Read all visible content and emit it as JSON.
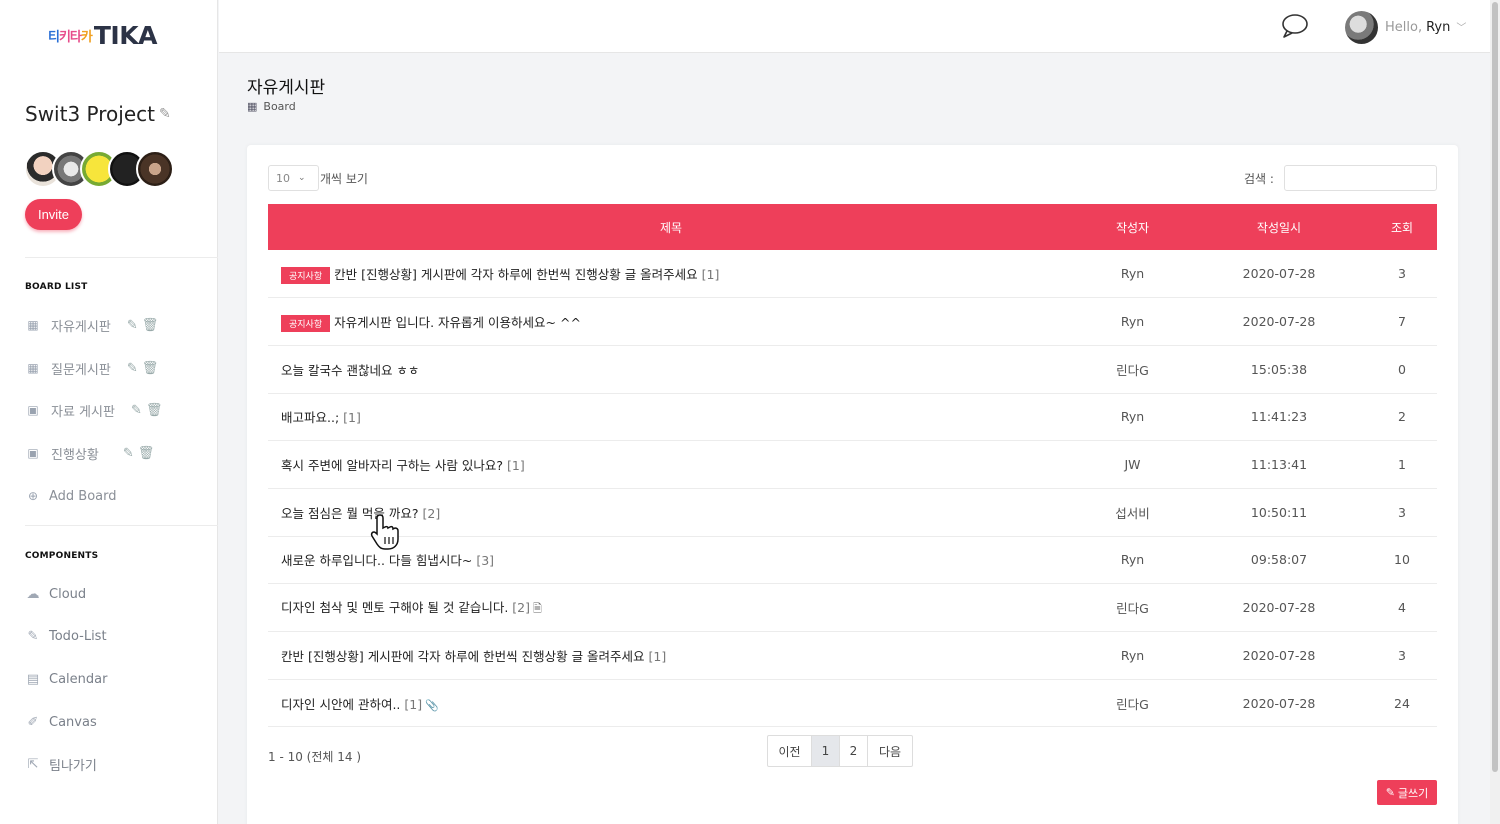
{
  "logo": {
    "ko_1": "티",
    "ko_2": "키타",
    "ko_3": "카",
    "en": "TIKA"
  },
  "project": {
    "title": "Swit3 Project",
    "invite": "Invite"
  },
  "sidebar": {
    "board_list_title": "BOARD LIST",
    "boards": [
      {
        "label": "자유게시판",
        "icon": "table-icon"
      },
      {
        "label": "질문게시판",
        "icon": "table-icon"
      },
      {
        "label": "자료 게시판",
        "icon": "book-icon"
      },
      {
        "label": "진행상황",
        "icon": "book-icon"
      }
    ],
    "add_board": "Add Board",
    "components_title": "COMPONENTS",
    "components": [
      {
        "label": "Cloud",
        "icon": "cloud-icon"
      },
      {
        "label": "Todo-List",
        "icon": "edit-icon"
      },
      {
        "label": "Calendar",
        "icon": "calendar-icon"
      },
      {
        "label": "Canvas",
        "icon": "brush-icon"
      },
      {
        "label": "팀나가기",
        "icon": "exit-icon"
      }
    ]
  },
  "header": {
    "hello": "Hello,",
    "user": "Ryn"
  },
  "page": {
    "title": "자유게시판",
    "sub": "Board"
  },
  "table": {
    "length_value": "10",
    "length_label": "개씩 보기",
    "search_label": "검색 :",
    "columns": [
      "제목",
      "작성자",
      "작성일시",
      "조회"
    ],
    "notice_badge": "공지사항",
    "rows": [
      {
        "notice": true,
        "title": "칸반 [진행상황] 게시판에 각자 하루에 한번씩 진행상황 글 올려주세요",
        "comments": "[1]",
        "author": "Ryn",
        "date": "2020-07-28",
        "views": "3"
      },
      {
        "notice": true,
        "title": "자유게시판 입니다. 자유롭게 이용하세요~ ^^",
        "comments": "",
        "author": "Ryn",
        "date": "2020-07-28",
        "views": "7"
      },
      {
        "notice": false,
        "title": "오늘 칼국수 괜찮네요 ㅎㅎ",
        "comments": "",
        "author": "린다G",
        "date": "15:05:38",
        "views": "0"
      },
      {
        "notice": false,
        "title": "배고파요..;",
        "comments": "[1]",
        "author": "Ryn",
        "date": "11:41:23",
        "views": "2"
      },
      {
        "notice": false,
        "title": "혹시 주변에 알바자리 구하는 사람 있나요?",
        "comments": "[1]",
        "author": "JW",
        "date": "11:13:41",
        "views": "1"
      },
      {
        "notice": false,
        "title": "오늘 점심은 뭘 먹을 까요?",
        "comments": "[2]",
        "author": "섭서비",
        "date": "10:50:11",
        "views": "3"
      },
      {
        "notice": false,
        "title": "새로운 하루입니다.. 다들 힘냅시다~",
        "comments": "[3]",
        "author": "Ryn",
        "date": "09:58:07",
        "views": "10"
      },
      {
        "notice": false,
        "title": "디자인 첨삭 및 멘토 구해야 될 것 같습니다.",
        "comments": "[2]",
        "author": "린다G",
        "date": "2020-07-28",
        "views": "4",
        "attach": "file-icon"
      },
      {
        "notice": false,
        "title": "칸반 [진행상황] 게시판에 각자 하루에 한번씩 진행상황 글 올려주세요",
        "comments": "[1]",
        "author": "Ryn",
        "date": "2020-07-28",
        "views": "3"
      },
      {
        "notice": false,
        "title": "디자인 시안에 관하여..",
        "comments": "[1]",
        "author": "린다G",
        "date": "2020-07-28",
        "views": "24",
        "attach": "paperclip-icon"
      }
    ],
    "summary": "1 - 10 (전체 14 )",
    "pager": {
      "prev": "이전",
      "pages": [
        "1",
        "2"
      ],
      "next": "다음"
    },
    "write": "글쓰기"
  },
  "colors": {
    "accent": "#ee3f5a"
  }
}
